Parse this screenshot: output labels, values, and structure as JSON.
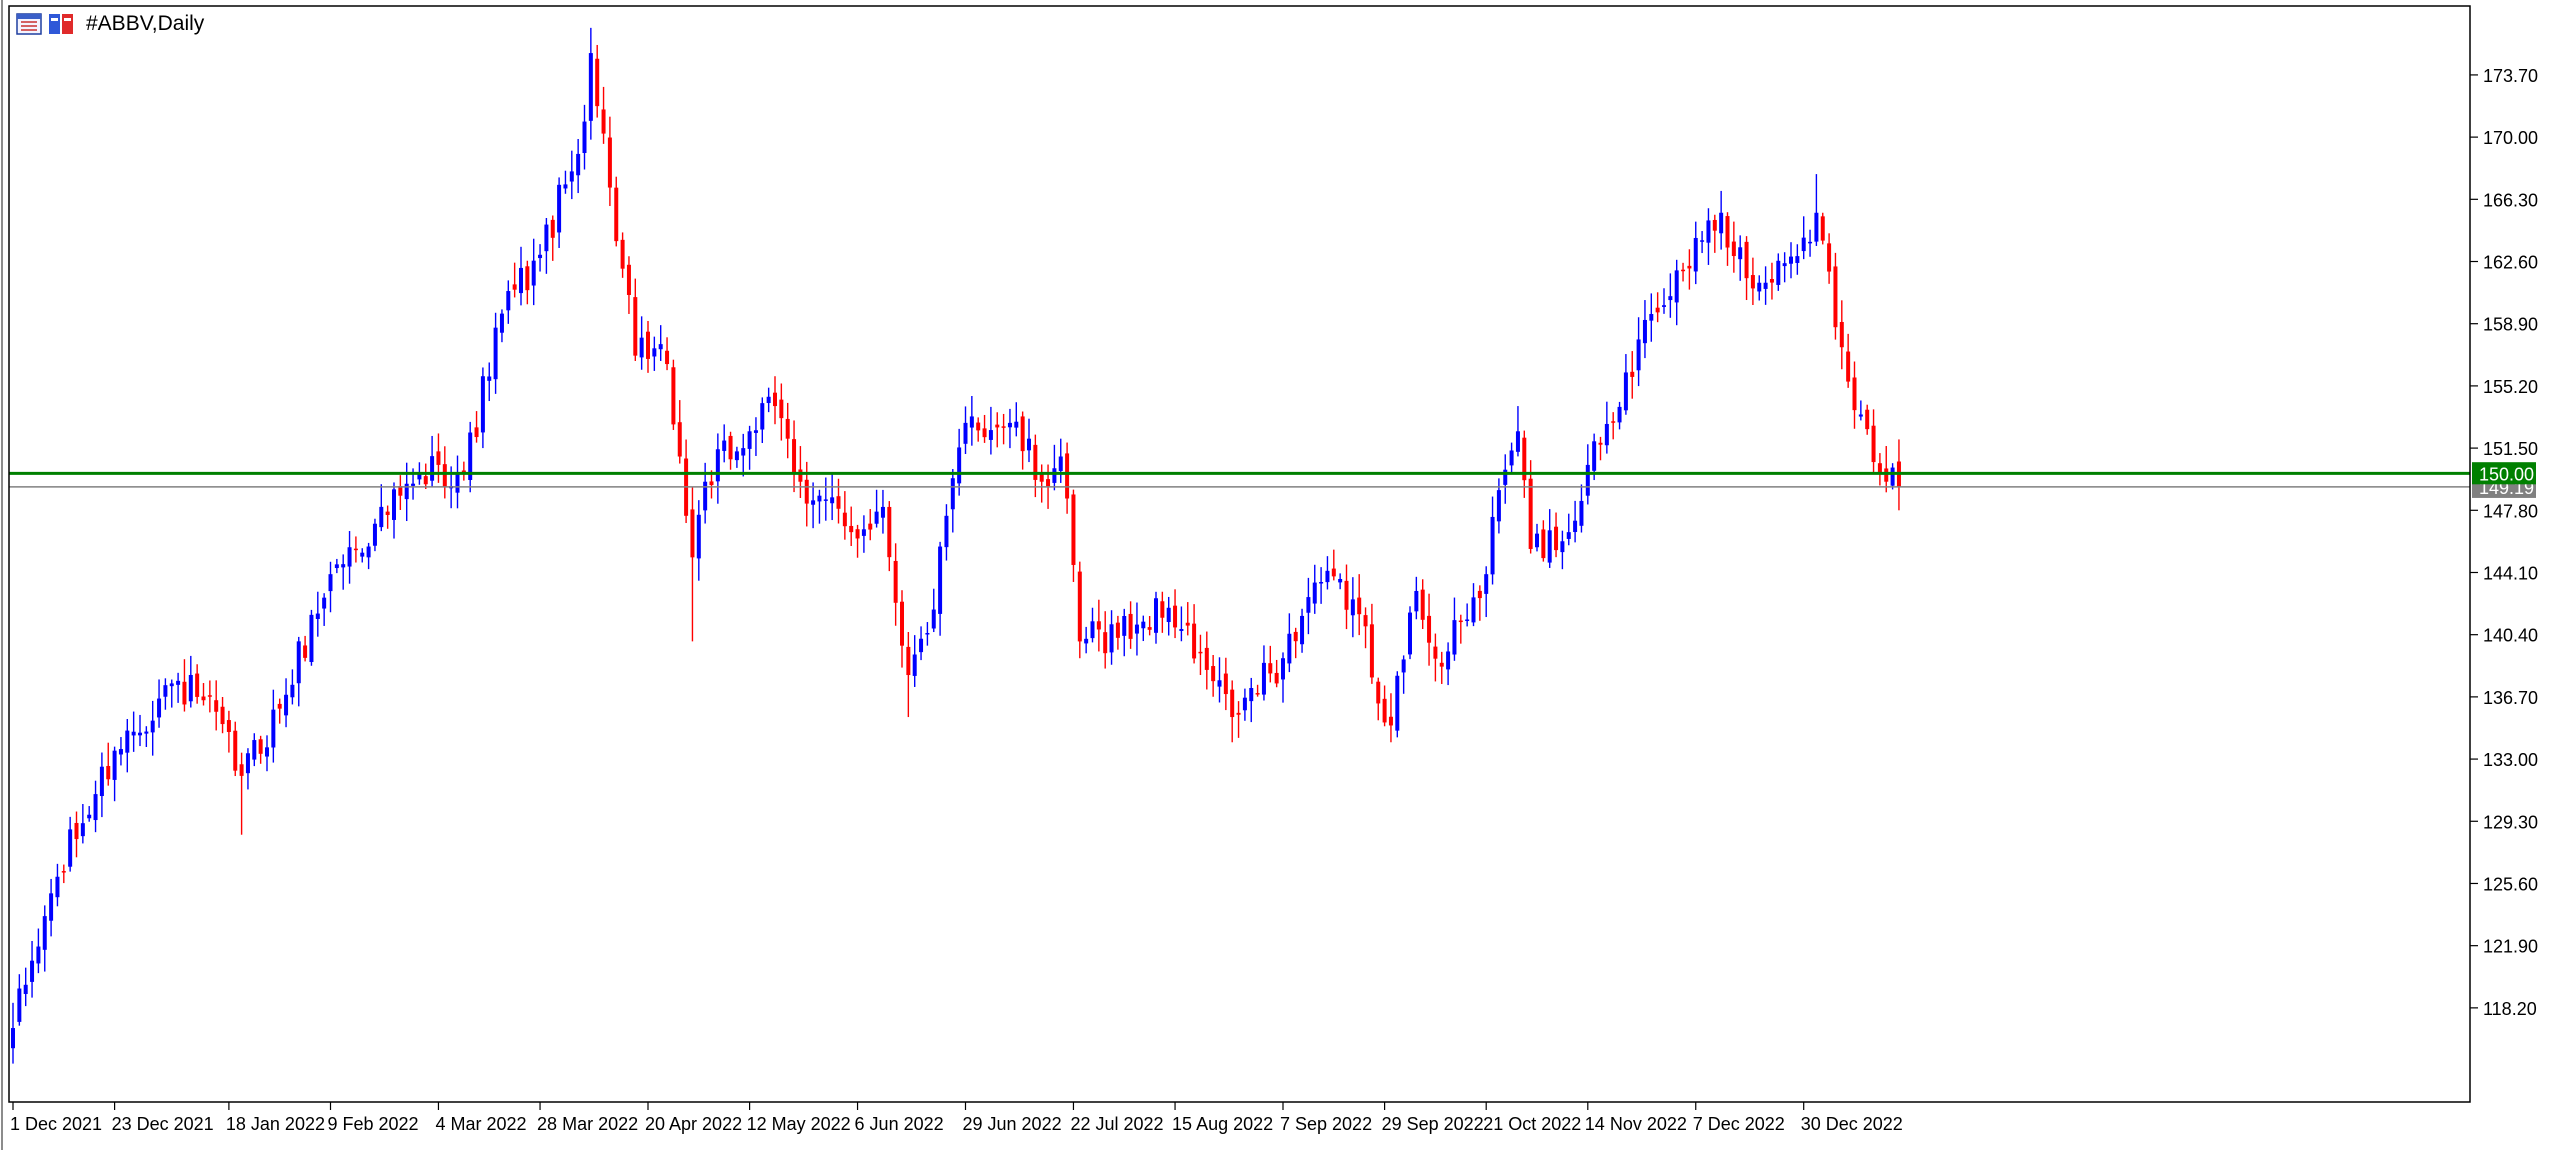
{
  "window": {
    "title": "#ABBV,Daily"
  },
  "colors": {
    "bull": "#0000ff",
    "bear": "#ff0000",
    "support_line": "#008000",
    "bid_line": "#808080",
    "frame": "#000000",
    "text": "#000000",
    "support_label_text": "#ffffff"
  },
  "icons": [
    "chart-window-icon",
    "chart-window-icon-color"
  ],
  "chart_data": {
    "type": "candlestick",
    "title": "#ABBV,Daily",
    "xlabel": "",
    "ylabel": "",
    "ylim": [
      112.6,
      177.8
    ],
    "grid": false,
    "y_ticks": [
      "173.70",
      "170.00",
      "166.30",
      "162.60",
      "158.90",
      "155.20",
      "151.50",
      "147.80",
      "144.10",
      "140.40",
      "136.70",
      "133.00",
      "129.30",
      "125.60",
      "121.90",
      "118.20"
    ],
    "x_ticks": [
      {
        "date": "2021-12-01",
        "label": "1 Dec 2021"
      },
      {
        "date": "2021-12-23",
        "label": "23 Dec 2021"
      },
      {
        "date": "2022-01-18",
        "label": "18 Jan 2022"
      },
      {
        "date": "2022-02-09",
        "label": "9 Feb 2022"
      },
      {
        "date": "2022-03-04",
        "label": "4 Mar 2022"
      },
      {
        "date": "2022-03-28",
        "label": "28 Mar 2022"
      },
      {
        "date": "2022-04-20",
        "label": "20 Apr 2022"
      },
      {
        "date": "2022-05-12",
        "label": "12 May 2022"
      },
      {
        "date": "2022-06-06",
        "label": "6 Jun 2022"
      },
      {
        "date": "2022-06-29",
        "label": "29 Jun 2022"
      },
      {
        "date": "2022-07-22",
        "label": "22 Jul 2022"
      },
      {
        "date": "2022-08-15",
        "label": "15 Aug 2022"
      },
      {
        "date": "2022-09-07",
        "label": "7 Sep 2022"
      },
      {
        "date": "2022-09-29",
        "label": "29 Sep 2022"
      },
      {
        "date": "2022-10-21",
        "label": "21 Oct 2022"
      },
      {
        "date": "2022-11-14",
        "label": "14 Nov 2022"
      },
      {
        "date": "2022-12-07",
        "label": "7 Dec 2022"
      },
      {
        "date": "2022-12-30",
        "label": "30 Dec 2022"
      }
    ],
    "horizontal_lines": [
      {
        "value": 150.0,
        "label": "150.00",
        "color": "#008000"
      },
      {
        "value": 149.19,
        "label": "149.19",
        "color": "#808080"
      }
    ],
    "anchors": [
      {
        "date": "2021-12-01",
        "close": 117.0,
        "low": 115.0,
        "high": 118.5
      },
      {
        "date": "2021-12-10",
        "close": 126.0
      },
      {
        "date": "2021-12-23",
        "close": 133.5
      },
      {
        "date": "2022-01-05",
        "close": 137.5
      },
      {
        "date": "2022-01-12",
        "close": 136.5
      },
      {
        "date": "2022-01-20",
        "close": 132.0,
        "low": 128.5
      },
      {
        "date": "2022-01-28",
        "close": 136.0
      },
      {
        "date": "2022-02-09",
        "close": 144.0
      },
      {
        "date": "2022-02-18",
        "close": 147.0
      },
      {
        "date": "2022-03-04",
        "close": 150.5
      },
      {
        "date": "2022-03-10",
        "close": 150.0
      },
      {
        "date": "2022-03-18",
        "close": 159.5
      },
      {
        "date": "2022-03-28",
        "close": 163.0
      },
      {
        "date": "2022-04-05",
        "close": 169.0
      },
      {
        "date": "2022-04-07",
        "close": 175.0,
        "high": 176.5
      },
      {
        "date": "2022-04-12",
        "close": 167.0
      },
      {
        "date": "2022-04-18",
        "close": 157.0
      },
      {
        "date": "2022-04-25",
        "close": 156.5
      },
      {
        "date": "2022-04-29",
        "close": 145.0,
        "low": 140.0
      },
      {
        "date": "2022-05-03",
        "close": 149.5
      },
      {
        "date": "2022-05-12",
        "close": 152.5
      },
      {
        "date": "2022-05-18",
        "close": 154.0
      },
      {
        "date": "2022-05-24",
        "close": 149.5
      },
      {
        "date": "2022-06-03",
        "close": 146.5
      },
      {
        "date": "2022-06-10",
        "close": 148.0
      },
      {
        "date": "2022-06-16",
        "close": 138.0,
        "low": 135.5
      },
      {
        "date": "2022-06-21",
        "close": 140.5
      },
      {
        "date": "2022-06-29",
        "close": 153.0
      },
      {
        "date": "2022-07-08",
        "close": 153.0
      },
      {
        "date": "2022-07-15",
        "close": 149.5
      },
      {
        "date": "2022-07-20",
        "close": 151.0
      },
      {
        "date": "2022-07-25",
        "close": 140.0,
        "low": 139.0
      },
      {
        "date": "2022-08-05",
        "close": 141.0
      },
      {
        "date": "2022-08-12",
        "close": 142.0
      },
      {
        "date": "2022-08-26",
        "close": 135.5,
        "low": 134.0
      },
      {
        "date": "2022-09-07",
        "close": 139.0
      },
      {
        "date": "2022-09-14",
        "close": 143.5
      },
      {
        "date": "2022-09-22",
        "close": 142.5
      },
      {
        "date": "2022-09-30",
        "close": 135.0,
        "low": 134.0
      },
      {
        "date": "2022-10-06",
        "close": 143.0
      },
      {
        "date": "2022-10-12",
        "close": 138.5
      },
      {
        "date": "2022-10-21",
        "close": 144.0
      },
      {
        "date": "2022-10-25",
        "close": 149.0
      },
      {
        "date": "2022-10-28",
        "close": 152.5,
        "high": 154.0
      },
      {
        "date": "2022-11-01",
        "close": 145.5
      },
      {
        "date": "2022-11-09",
        "close": 146.5
      },
      {
        "date": "2022-11-14",
        "close": 150.5
      },
      {
        "date": "2022-11-22",
        "close": 156.0
      },
      {
        "date": "2022-11-30",
        "close": 160.0
      },
      {
        "date": "2022-12-07",
        "close": 164.0
      },
      {
        "date": "2022-12-13",
        "close": 165.5,
        "high": 166.8
      },
      {
        "date": "2022-12-20",
        "close": 161.0
      },
      {
        "date": "2022-12-27",
        "close": 162.5
      },
      {
        "date": "2023-01-03",
        "close": 165.5,
        "high": 167.8
      },
      {
        "date": "2023-01-09",
        "close": 157.5
      },
      {
        "date": "2023-01-12",
        "close": 153.5
      },
      {
        "date": "2023-01-17",
        "close": 150.0
      },
      {
        "date": "2023-01-20",
        "close": 149.19
      }
    ]
  }
}
